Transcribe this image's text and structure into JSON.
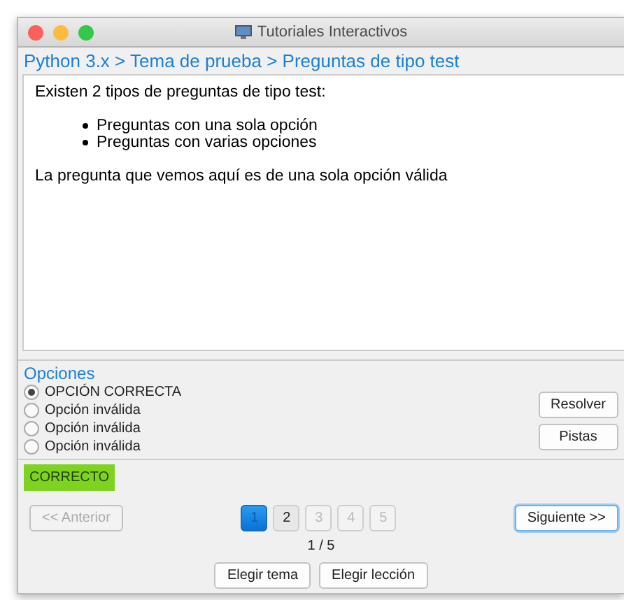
{
  "window": {
    "title": "Tutoriales Interactivos"
  },
  "breadcrumb": "Python 3.x > Tema de prueba > Preguntas de tipo test",
  "content": {
    "intro": "Existen 2 tipos de preguntas de tipo test:",
    "bullets": [
      "Preguntas con una sola opción",
      "Preguntas con varias opciones"
    ],
    "note": "La pregunta que vemos aquí es de una sola opción válida"
  },
  "options": {
    "heading": "Opciones",
    "items": [
      {
        "label": "OPCIÓN CORRECTA",
        "selected": true
      },
      {
        "label": "Opción inválida",
        "selected": false
      },
      {
        "label": "Opción inválida",
        "selected": false
      },
      {
        "label": "Opción inválida",
        "selected": false
      }
    ],
    "buttons": [
      "Resolver",
      "Pistas"
    ]
  },
  "result": {
    "text": "CORRECTO",
    "color": "#7ed321"
  },
  "navigation": {
    "previous": {
      "label": "<< Anterior",
      "disabled": true
    },
    "pages": [
      {
        "label": "1",
        "selected": true,
        "disabled": false
      },
      {
        "label": "2",
        "selected": false,
        "disabled": false
      },
      {
        "label": "3",
        "selected": false,
        "disabled": true
      },
      {
        "label": "4",
        "selected": false,
        "disabled": true
      },
      {
        "label": "5",
        "selected": false,
        "disabled": true
      }
    ],
    "next": {
      "label": "Siguiente >>",
      "disabled": false
    },
    "counter": "1 / 5"
  },
  "footer_buttons": [
    "Elegir tema",
    "Elegir lección"
  ]
}
